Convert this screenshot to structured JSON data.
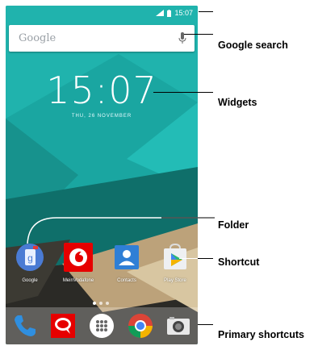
{
  "status_bar": {
    "time": "15:07"
  },
  "search": {
    "placeholder": "Google"
  },
  "clock_widget": {
    "time": "15:07",
    "date": "THU, 26 NOVEMBER"
  },
  "apps": [
    {
      "label": "Google",
      "icon": "google-search-icon"
    },
    {
      "label": "MeinVodafone",
      "icon": "vodafone-icon"
    },
    {
      "label": "Contacts",
      "icon": "contacts-icon"
    },
    {
      "label": "Play Store",
      "icon": "play-store-icon"
    }
  ],
  "dock": [
    {
      "icon": "phone-icon"
    },
    {
      "icon": "messages-icon"
    },
    {
      "icon": "app-drawer-icon"
    },
    {
      "icon": "chrome-icon"
    },
    {
      "icon": "camera-icon"
    }
  ],
  "callouts": {
    "search": "Google search",
    "widgets": "Widgets",
    "folder": "Folder",
    "shortcut": "Shortcut",
    "primary": "Primary shortcuts"
  },
  "colors": {
    "wallpaper_teal": "#1aa6a1",
    "wallpaper_dark": "#1f3a36",
    "wallpaper_tan": "#c8b28a"
  }
}
